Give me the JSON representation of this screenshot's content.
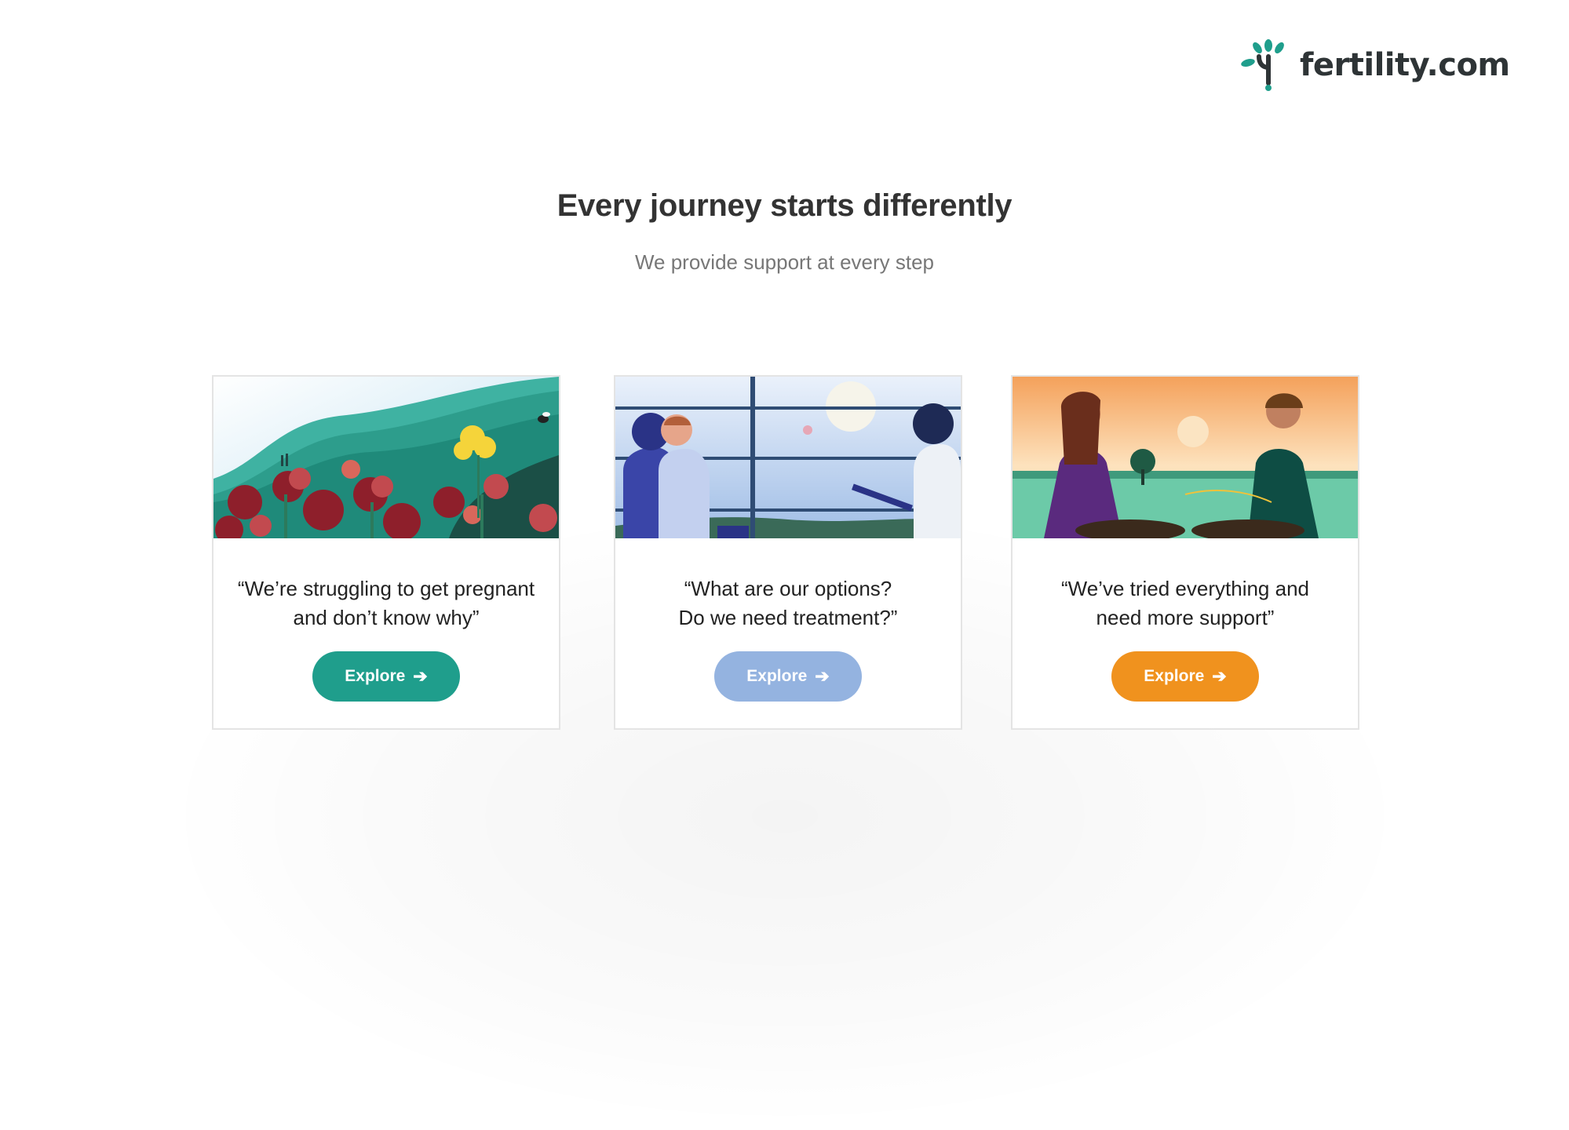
{
  "brand": {
    "name": "fertility.com",
    "colors": {
      "teal": "#1f9e8c",
      "text": "#2e3436"
    }
  },
  "hero": {
    "title": "Every journey starts differently",
    "subtitle": "We provide support at every step"
  },
  "cards": [
    {
      "image": "illustration-flowers-hills",
      "quote_line1": "“We’re struggling to get pregnant",
      "quote_line2": "and don’t know why”",
      "button_label": "Explore",
      "button_icon": "arrow-right-icon",
      "button_color": "#1f9e8c"
    },
    {
      "image": "illustration-couple-consultation",
      "quote_line1": "“What are our options?",
      "quote_line2": "Do we need treatment?”",
      "button_label": "Explore",
      "button_icon": "arrow-right-icon",
      "button_color": "#94b3e0"
    },
    {
      "image": "illustration-meditation-sunset",
      "quote_line1": "“We’ve tried everything and",
      "quote_line2": "need more support”",
      "button_label": "Explore",
      "button_icon": "arrow-right-icon",
      "button_color": "#f0921e"
    }
  ]
}
